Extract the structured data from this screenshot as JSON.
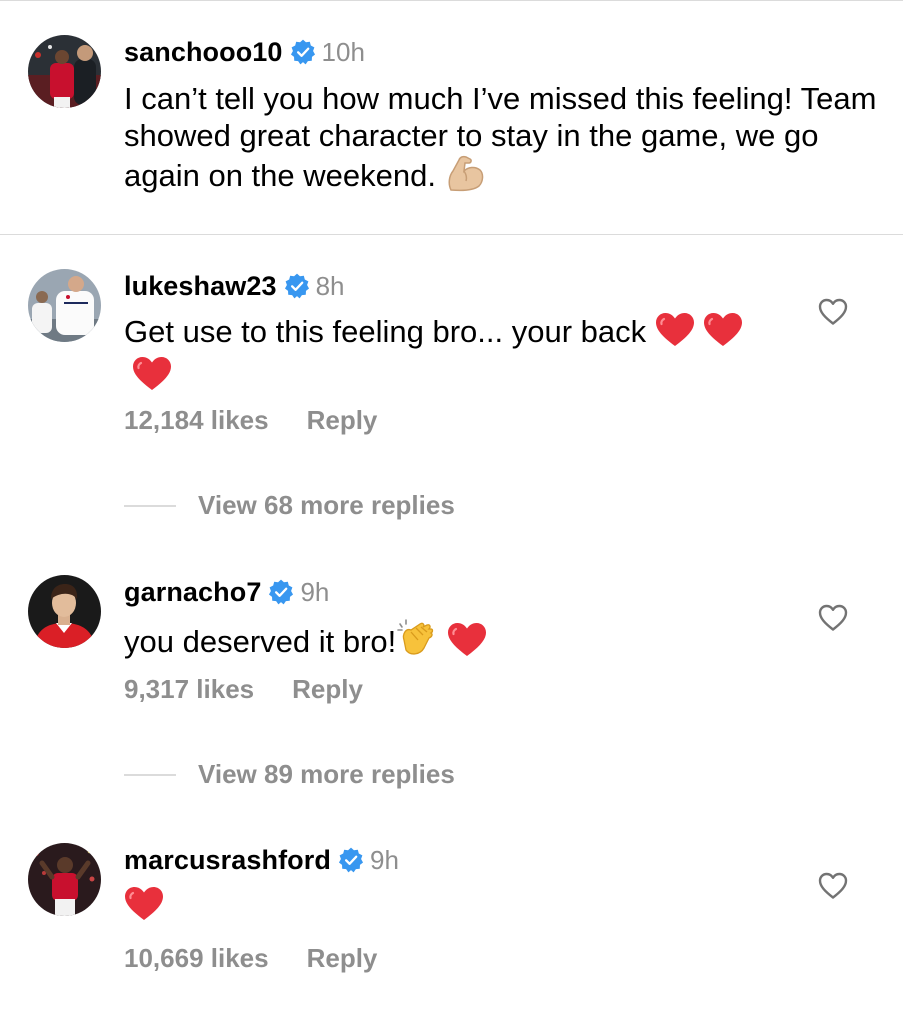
{
  "post": {
    "username": "sanchooo10",
    "time": "10h",
    "caption": "I can’t tell you how much I’ve missed this feeling! Team showed great character to stay in the game, we go again on the weekend.",
    "caption_emoji": "flexed-biceps"
  },
  "comments": [
    {
      "username": "lukeshaw23",
      "time": "8h",
      "text": "Get use to this feeling bro... your back",
      "emojis": [
        "red-heart",
        "red-heart",
        "red-heart"
      ],
      "likes": "12,184 likes",
      "reply_label": "Reply",
      "view_replies": "View 68 more replies"
    },
    {
      "username": "garnacho7",
      "time": "9h",
      "text": "you deserved it bro!",
      "emojis": [
        "clapping-hands",
        "red-heart"
      ],
      "likes": "9,317 likes",
      "reply_label": "Reply",
      "view_replies": "View 89 more replies"
    },
    {
      "username": "marcusrashford",
      "time": "9h",
      "text": "",
      "emojis": [
        "red-heart"
      ],
      "likes": "10,669 likes",
      "reply_label": "Reply"
    }
  ],
  "colors": {
    "verified": "#3897f0",
    "muted": "#8e8e8e",
    "heart": "#e0245e",
    "divider": "#dbdbdb"
  }
}
